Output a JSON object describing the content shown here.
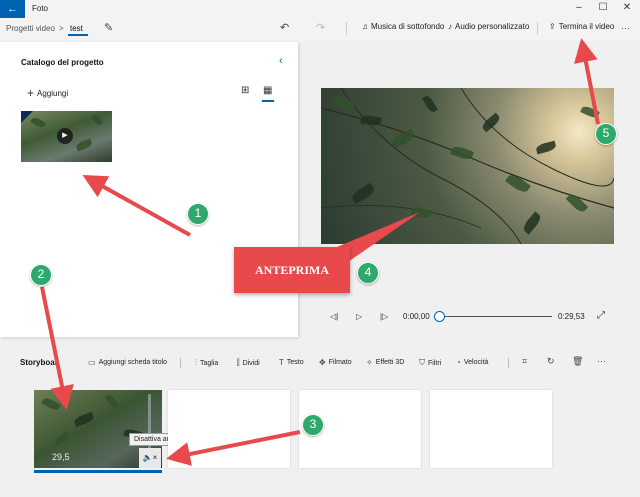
{
  "titlebar": {
    "back_glyph": "←",
    "app_title": "Foto",
    "minimize_glyph": "–",
    "maximize_glyph": "☐",
    "close_glyph": "✕"
  },
  "toolbar": {
    "breadcrumb_root": "Progetti video",
    "breadcrumb_sep": ">",
    "breadcrumb_current": "test",
    "rename_glyph": "✎",
    "undo_glyph": "↶",
    "redo_glyph": "↷",
    "music_label": "Musica di sottofondo",
    "custom_audio_label": "Audio personalizzato",
    "finish_label": "Termina il video",
    "more_glyph": "···"
  },
  "catalog": {
    "title": "Catalogo del progetto",
    "collapse_glyph": "‹",
    "add_label": "Aggiungi",
    "add_glyph": "+",
    "view_grid_large_glyph": "⊞",
    "view_grid_small_glyph": "▦",
    "play_glyph": "▶"
  },
  "player": {
    "prev_glyph": "◁|",
    "play_glyph": "▷",
    "next_glyph": "|▷",
    "current_time": "0:00,00",
    "total_time": "0:29,53",
    "fullscreen_glyph": "⤢",
    "progress": 0
  },
  "storyboard": {
    "label": "Storyboar",
    "add_title_card": "Aggiungi scheda titolo",
    "trim": "Taglia",
    "split": "Dividi",
    "text": "Testo",
    "motion": "Filmato",
    "effects_3d": "Effetti 3D",
    "filters": "Filtri",
    "speed": "Velocità",
    "clip_duration": "29,5",
    "mute_tooltip": "Disattiva audio",
    "mute_glyph": "🔈×",
    "more_glyph": "···"
  },
  "annotations": {
    "callout_text": "ANTEPRIMA",
    "badge_1": "1",
    "badge_2": "2",
    "badge_3": "3",
    "badge_4": "4",
    "badge_5": "5",
    "arrow_color": "#e8494a",
    "badge_color": "#2fa86d"
  },
  "colors": {
    "accent": "#0063b1",
    "panel": "#ffffff",
    "background": "#f0f0f0"
  }
}
